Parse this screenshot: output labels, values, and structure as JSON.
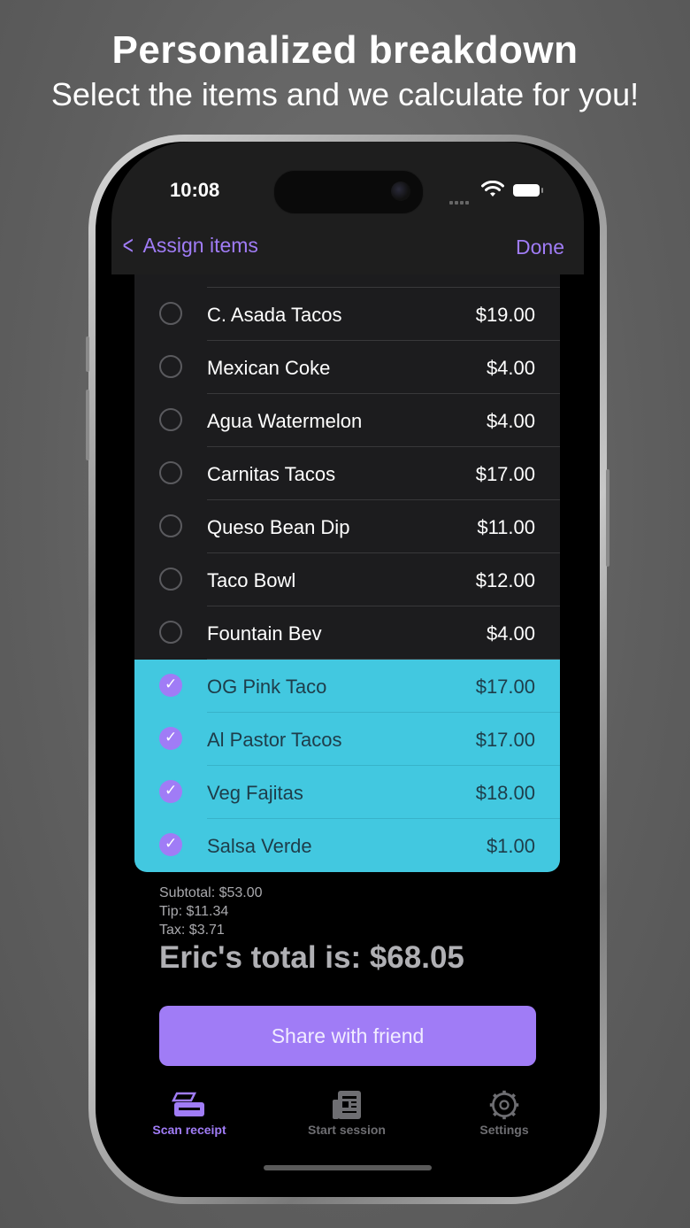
{
  "promo": {
    "title": "Personalized breakdown",
    "subtitle": "Select the items and we calculate for you!"
  },
  "status_bar": {
    "time": "10:08",
    "icons": [
      "signal-icon",
      "wifi-icon",
      "battery-icon"
    ]
  },
  "nav": {
    "back_label": "Assign items",
    "done_label": "Done"
  },
  "items": [
    {
      "name": "C. Asada Tacos",
      "price": "$19.00",
      "selected": false
    },
    {
      "name": "Mexican Coke",
      "price": "$4.00",
      "selected": false
    },
    {
      "name": "Agua Watermelon",
      "price": "$4.00",
      "selected": false
    },
    {
      "name": "Carnitas Tacos",
      "price": "$17.00",
      "selected": false
    },
    {
      "name": "Queso Bean Dip",
      "price": "$11.00",
      "selected": false
    },
    {
      "name": "Taco Bowl",
      "price": "$12.00",
      "selected": false
    },
    {
      "name": "Fountain Bev",
      "price": "$4.00",
      "selected": false
    },
    {
      "name": "OG Pink Taco",
      "price": "$17.00",
      "selected": true
    },
    {
      "name": "Al Pastor Tacos",
      "price": "$17.00",
      "selected": true
    },
    {
      "name": "Veg Fajitas",
      "price": "$18.00",
      "selected": true
    },
    {
      "name": "Salsa Verde",
      "price": "$1.00",
      "selected": true
    }
  ],
  "summary": {
    "subtotal": "Subtotal: $53.00",
    "tip": "Tip: $11.34",
    "tax": "Tax: $3.71",
    "total": "Eric's total is: $68.05"
  },
  "share_button": "Share with friend",
  "tabs": [
    {
      "label": "Scan receipt",
      "icon": "scanner-icon",
      "active": true
    },
    {
      "label": "Start session",
      "icon": "newspaper-icon",
      "active": false
    },
    {
      "label": "Settings",
      "icon": "gear-icon",
      "active": false
    }
  ],
  "colors": {
    "accent": "#a07cf6",
    "selected_row": "#42c8e0",
    "list_bg": "#1c1c1e"
  }
}
